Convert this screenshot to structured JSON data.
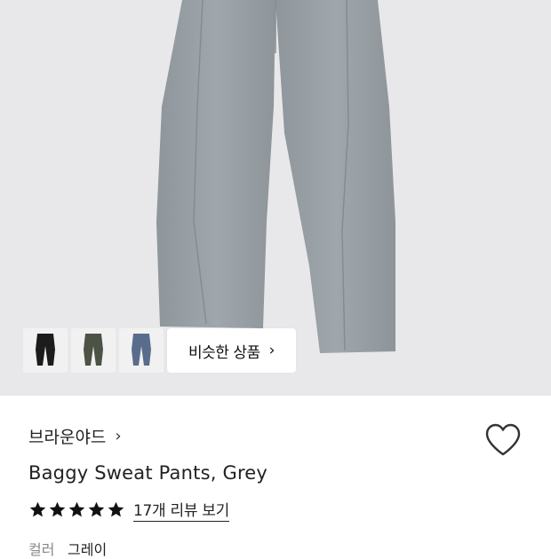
{
  "similar": {
    "thumbnails": [
      {
        "name": "black",
        "color": "#1c1c1c"
      },
      {
        "name": "olive",
        "color": "#4c5244"
      },
      {
        "name": "navy",
        "color": "#5a6c8c"
      }
    ],
    "button_label": "비슷한 상품",
    "chevron": "›"
  },
  "product": {
    "brand": "브라운야드",
    "brand_chevron": "›",
    "title": "Baggy Sweat Pants, Grey",
    "rating": 5,
    "review_link": "17개 리뷰 보기",
    "color_label": "컬러",
    "color_value": "그레이",
    "main_color": "#9ba2a7"
  },
  "icons": {
    "wishlist": "heart-outline-icon",
    "star": "star-filled-icon"
  }
}
